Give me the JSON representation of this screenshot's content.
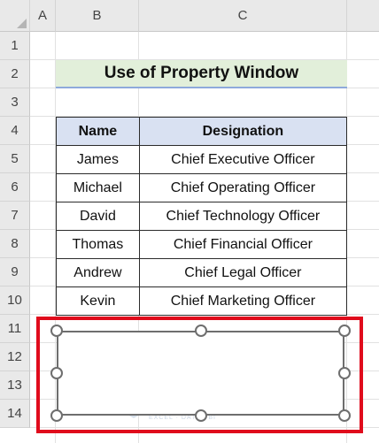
{
  "sheet": {
    "columns": [
      "A",
      "B",
      "C"
    ],
    "rows": [
      "1",
      "2",
      "3",
      "4",
      "5",
      "6",
      "7",
      "8",
      "9",
      "10",
      "11",
      "12",
      "13",
      "14"
    ]
  },
  "title": "Use of Property Window",
  "table": {
    "headers": [
      "Name",
      "Designation"
    ],
    "rows": [
      [
        "James",
        "Chief Executive Officer"
      ],
      [
        "Michael",
        "Chief Operating Officer"
      ],
      [
        "David",
        "Chief Technology Officer"
      ],
      [
        "Thomas",
        "Chief Financial Officer"
      ],
      [
        "Andrew",
        "Chief Legal Officer"
      ],
      [
        "Kevin",
        "Chief Marketing Officer"
      ]
    ]
  },
  "watermark": {
    "name": "exceldemy",
    "tagline": "EXCEL · DATA · BI"
  },
  "colors": {
    "title_fill": "#e2efda",
    "header_fill": "#d9e1f2",
    "highlight_border": "#e00b1c"
  }
}
